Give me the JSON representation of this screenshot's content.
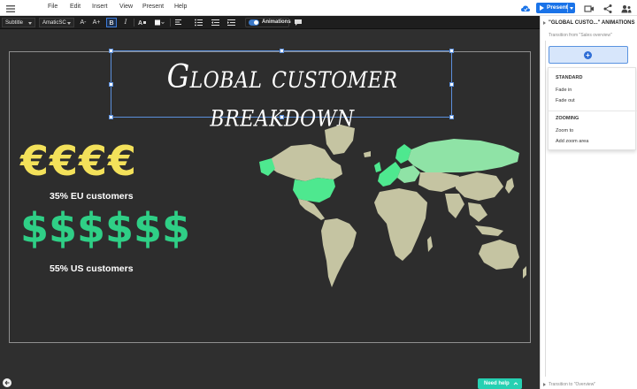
{
  "menu": {
    "items": [
      "File",
      "Edit",
      "Insert",
      "View",
      "Present",
      "Help"
    ],
    "present_label": "Present"
  },
  "toolbar": {
    "style_select": "Subtitle",
    "font_select": "AmaticSC",
    "font_decrease": "A-",
    "font_increase": "A+",
    "bold": "B",
    "italic": "I",
    "animations_label": "Animations"
  },
  "slide": {
    "title": "Global customer breakdown",
    "euro_symbols": "€€€€",
    "dollar_symbols": "$$$$$$",
    "eu_stat": "35% EU customers",
    "us_stat": "55% US customers"
  },
  "panel": {
    "title": "\"GLOBAL CUSTO...\" ANIMATIONS",
    "transition_from": "Transition from \"Sales overview\"",
    "add_symbol": "+",
    "standard_heading": "STANDARD",
    "fade_in": "Fade in",
    "fade_out": "Fade out",
    "zooming_heading": "ZOOMING",
    "zoom_to": "Zoom to",
    "add_zoom_area": "Add zoom area",
    "transition_to": "Transition to \"Overview\""
  },
  "help": {
    "label": "Need help"
  },
  "colors": {
    "accent": "#1a73e8",
    "euro": "#f3e15a",
    "dollar": "#2fcf86",
    "map_land": "#c5c4a2",
    "map_highlight": "#4ee88f",
    "help": "#26d0b2"
  }
}
